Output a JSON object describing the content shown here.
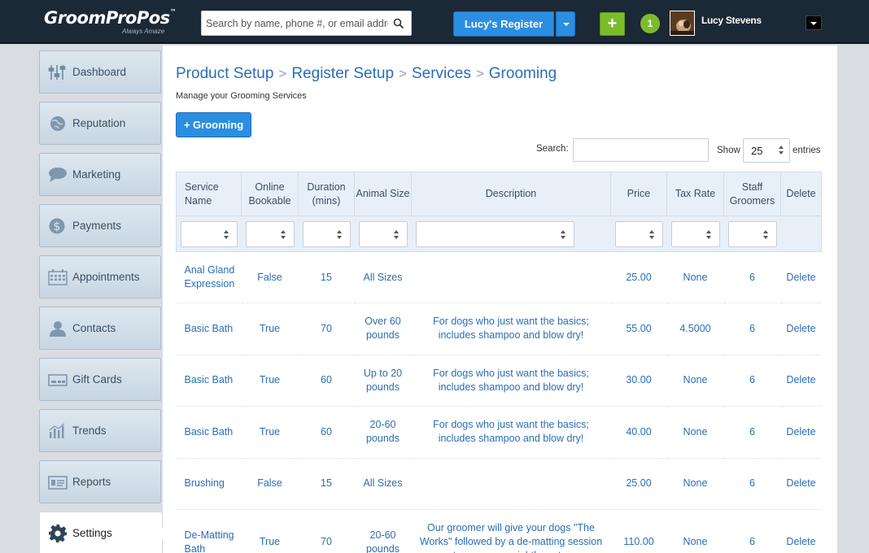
{
  "header": {
    "logo": "GroomProPos",
    "logo_tagline": "Always Amaze",
    "search_placeholder": "Search by name, phone #, or email address",
    "register_label": "Lucy's Register",
    "add_label": "+",
    "notification_count": "1",
    "user_name": "Lucy Stevens"
  },
  "sidebar": {
    "items": [
      {
        "label": "Dashboard",
        "icon": "sliders-icon"
      },
      {
        "label": "Reputation",
        "icon": "globe-icon"
      },
      {
        "label": "Marketing",
        "icon": "speech-bubble-icon"
      },
      {
        "label": "Payments",
        "icon": "dollar-coin-icon"
      },
      {
        "label": "Appointments",
        "icon": "calendar-icon"
      },
      {
        "label": "Contacts",
        "icon": "person-icon"
      },
      {
        "label": "Gift Cards",
        "icon": "gift-card-icon"
      },
      {
        "label": "Trends",
        "icon": "bar-chart-icon"
      },
      {
        "label": "Reports",
        "icon": "report-icon"
      },
      {
        "label": "Settings",
        "icon": "gear-icon",
        "active": true
      }
    ]
  },
  "page": {
    "breadcrumb": [
      "Product Setup",
      "Register Setup",
      "Services",
      "Grooming"
    ],
    "breadcrumb_separator": ">",
    "subtitle": "Manage your Grooming Services",
    "add_button": "+ Grooming",
    "search_label": "Search:",
    "show_label": "Show",
    "show_value": "25",
    "entries_label": "entries"
  },
  "table": {
    "columns": [
      "Service Name",
      "Online Bookable",
      "Duration (mins)",
      "Animal Size",
      "Description",
      "Price",
      "Tax Rate",
      "Staff Groomers",
      "Delete"
    ],
    "rows": [
      [
        "Anal Gland Expression",
        "False",
        "15",
        "All Sizes",
        "",
        "25.00",
        "None",
        "6",
        "Delete"
      ],
      [
        "Basic Bath",
        "True",
        "70",
        "Over 60 pounds",
        "For dogs who just want the basics; includes shampoo and blow dry!",
        "55.00",
        "4.5000",
        "6",
        "Delete"
      ],
      [
        "Basic Bath",
        "True",
        "60",
        "Up to 20 pounds",
        "For dogs who just want the basics; includes shampoo and blow dry!",
        "30.00",
        "None",
        "6",
        "Delete"
      ],
      [
        "Basic Bath",
        "True",
        "60",
        "20-60 pounds",
        "For dogs who just want the basics; includes shampoo and blow dry!",
        "40.00",
        "None",
        "6",
        "Delete"
      ],
      [
        "Brushing",
        "False",
        "15",
        "All Sizes",
        "",
        "25.00",
        "None",
        "6",
        "Delete"
      ],
      [
        "De-Matting Bath",
        "True",
        "70",
        "20-60 pounds",
        "Our groomer will give your dogs \"The Works\" followed by a de-matting session to remove unsightly mats.",
        "110.00",
        "None",
        "6",
        "Delete"
      ]
    ]
  },
  "colors": {
    "topbar": "#1b2836",
    "accent_blue": "#2b8ee0",
    "accent_green": "#7dbb2d",
    "link_text": "#2a6eb5"
  }
}
